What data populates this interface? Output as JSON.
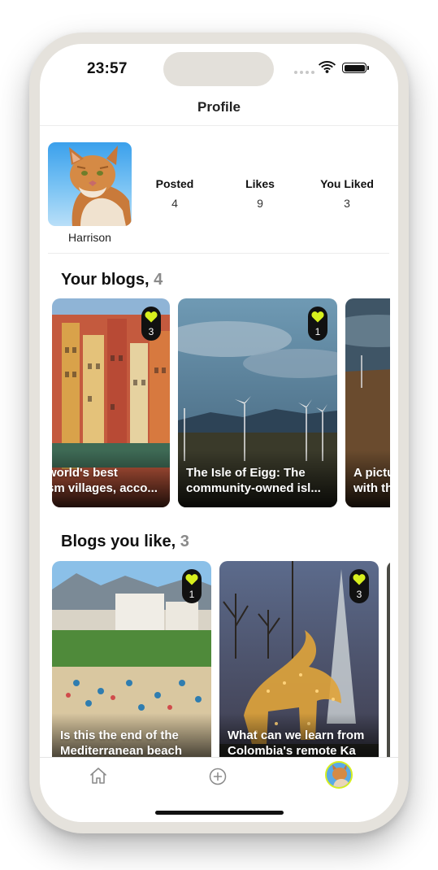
{
  "status_bar": {
    "time": "23:57"
  },
  "nav": {
    "title": "Profile"
  },
  "profile": {
    "name": "Harrison",
    "stats": [
      {
        "label": "Posted",
        "value": "4"
      },
      {
        "label": "Likes",
        "value": "9"
      },
      {
        "label": "You Liked",
        "value": "3"
      }
    ]
  },
  "your_blogs": {
    "title": "Your blogs,",
    "count": "4",
    "cards": [
      {
        "title_line1": "world's best",
        "title_line2": "sm villages, acco...",
        "likes": "3"
      },
      {
        "title_line1": "The Isle of Eigg: The",
        "title_line2": "community-owned isl...",
        "likes": "1"
      },
      {
        "title_line1": "A pictu",
        "title_line2": "with th",
        "likes": ""
      }
    ]
  },
  "liked_blogs": {
    "title": "Blogs you like,",
    "count": "3",
    "cards": [
      {
        "title_line1": "Is this the end of the",
        "title_line2": "Mediterranean beach",
        "likes": "1"
      },
      {
        "title_line1": "What can we learn from",
        "title_line2": "Colombia's remote Ka",
        "likes": "3"
      }
    ]
  },
  "colors": {
    "accent": "#d7ef1e",
    "badge_bg": "#111111"
  },
  "icons": {
    "tab_home": "home-icon",
    "tab_create": "add-circle-icon",
    "tab_profile": "avatar",
    "like": "heart-icon"
  }
}
